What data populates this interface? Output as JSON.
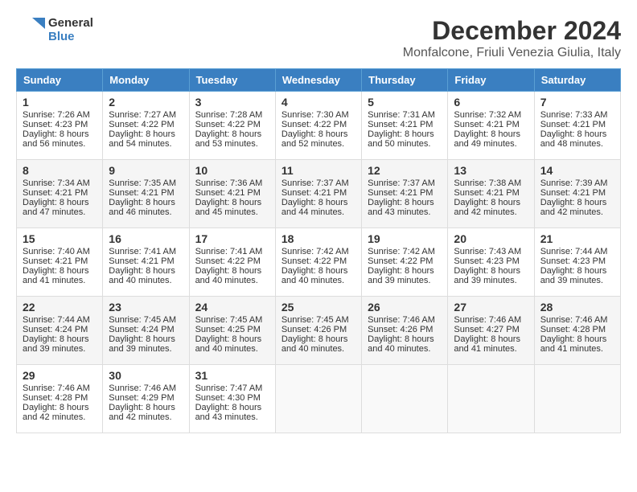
{
  "header": {
    "logo_line1": "General",
    "logo_line2": "Blue",
    "month_title": "December 2024",
    "location": "Monfalcone, Friuli Venezia Giulia, Italy"
  },
  "days_of_week": [
    "Sunday",
    "Monday",
    "Tuesday",
    "Wednesday",
    "Thursday",
    "Friday",
    "Saturday"
  ],
  "weeks": [
    [
      {
        "day": "1",
        "sunrise": "Sunrise: 7:26 AM",
        "sunset": "Sunset: 4:23 PM",
        "daylight": "Daylight: 8 hours and 56 minutes."
      },
      {
        "day": "2",
        "sunrise": "Sunrise: 7:27 AM",
        "sunset": "Sunset: 4:22 PM",
        "daylight": "Daylight: 8 hours and 54 minutes."
      },
      {
        "day": "3",
        "sunrise": "Sunrise: 7:28 AM",
        "sunset": "Sunset: 4:22 PM",
        "daylight": "Daylight: 8 hours and 53 minutes."
      },
      {
        "day": "4",
        "sunrise": "Sunrise: 7:30 AM",
        "sunset": "Sunset: 4:22 PM",
        "daylight": "Daylight: 8 hours and 52 minutes."
      },
      {
        "day": "5",
        "sunrise": "Sunrise: 7:31 AM",
        "sunset": "Sunset: 4:21 PM",
        "daylight": "Daylight: 8 hours and 50 minutes."
      },
      {
        "day": "6",
        "sunrise": "Sunrise: 7:32 AM",
        "sunset": "Sunset: 4:21 PM",
        "daylight": "Daylight: 8 hours and 49 minutes."
      },
      {
        "day": "7",
        "sunrise": "Sunrise: 7:33 AM",
        "sunset": "Sunset: 4:21 PM",
        "daylight": "Daylight: 8 hours and 48 minutes."
      }
    ],
    [
      {
        "day": "8",
        "sunrise": "Sunrise: 7:34 AM",
        "sunset": "Sunset: 4:21 PM",
        "daylight": "Daylight: 8 hours and 47 minutes."
      },
      {
        "day": "9",
        "sunrise": "Sunrise: 7:35 AM",
        "sunset": "Sunset: 4:21 PM",
        "daylight": "Daylight: 8 hours and 46 minutes."
      },
      {
        "day": "10",
        "sunrise": "Sunrise: 7:36 AM",
        "sunset": "Sunset: 4:21 PM",
        "daylight": "Daylight: 8 hours and 45 minutes."
      },
      {
        "day": "11",
        "sunrise": "Sunrise: 7:37 AM",
        "sunset": "Sunset: 4:21 PM",
        "daylight": "Daylight: 8 hours and 44 minutes."
      },
      {
        "day": "12",
        "sunrise": "Sunrise: 7:37 AM",
        "sunset": "Sunset: 4:21 PM",
        "daylight": "Daylight: 8 hours and 43 minutes."
      },
      {
        "day": "13",
        "sunrise": "Sunrise: 7:38 AM",
        "sunset": "Sunset: 4:21 PM",
        "daylight": "Daylight: 8 hours and 42 minutes."
      },
      {
        "day": "14",
        "sunrise": "Sunrise: 7:39 AM",
        "sunset": "Sunset: 4:21 PM",
        "daylight": "Daylight: 8 hours and 42 minutes."
      }
    ],
    [
      {
        "day": "15",
        "sunrise": "Sunrise: 7:40 AM",
        "sunset": "Sunset: 4:21 PM",
        "daylight": "Daylight: 8 hours and 41 minutes."
      },
      {
        "day": "16",
        "sunrise": "Sunrise: 7:41 AM",
        "sunset": "Sunset: 4:21 PM",
        "daylight": "Daylight: 8 hours and 40 minutes."
      },
      {
        "day": "17",
        "sunrise": "Sunrise: 7:41 AM",
        "sunset": "Sunset: 4:22 PM",
        "daylight": "Daylight: 8 hours and 40 minutes."
      },
      {
        "day": "18",
        "sunrise": "Sunrise: 7:42 AM",
        "sunset": "Sunset: 4:22 PM",
        "daylight": "Daylight: 8 hours and 40 minutes."
      },
      {
        "day": "19",
        "sunrise": "Sunrise: 7:42 AM",
        "sunset": "Sunset: 4:22 PM",
        "daylight": "Daylight: 8 hours and 39 minutes."
      },
      {
        "day": "20",
        "sunrise": "Sunrise: 7:43 AM",
        "sunset": "Sunset: 4:23 PM",
        "daylight": "Daylight: 8 hours and 39 minutes."
      },
      {
        "day": "21",
        "sunrise": "Sunrise: 7:44 AM",
        "sunset": "Sunset: 4:23 PM",
        "daylight": "Daylight: 8 hours and 39 minutes."
      }
    ],
    [
      {
        "day": "22",
        "sunrise": "Sunrise: 7:44 AM",
        "sunset": "Sunset: 4:24 PM",
        "daylight": "Daylight: 8 hours and 39 minutes."
      },
      {
        "day": "23",
        "sunrise": "Sunrise: 7:45 AM",
        "sunset": "Sunset: 4:24 PM",
        "daylight": "Daylight: 8 hours and 39 minutes."
      },
      {
        "day": "24",
        "sunrise": "Sunrise: 7:45 AM",
        "sunset": "Sunset: 4:25 PM",
        "daylight": "Daylight: 8 hours and 40 minutes."
      },
      {
        "day": "25",
        "sunrise": "Sunrise: 7:45 AM",
        "sunset": "Sunset: 4:26 PM",
        "daylight": "Daylight: 8 hours and 40 minutes."
      },
      {
        "day": "26",
        "sunrise": "Sunrise: 7:46 AM",
        "sunset": "Sunset: 4:26 PM",
        "daylight": "Daylight: 8 hours and 40 minutes."
      },
      {
        "day": "27",
        "sunrise": "Sunrise: 7:46 AM",
        "sunset": "Sunset: 4:27 PM",
        "daylight": "Daylight: 8 hours and 41 minutes."
      },
      {
        "day": "28",
        "sunrise": "Sunrise: 7:46 AM",
        "sunset": "Sunset: 4:28 PM",
        "daylight": "Daylight: 8 hours and 41 minutes."
      }
    ],
    [
      {
        "day": "29",
        "sunrise": "Sunrise: 7:46 AM",
        "sunset": "Sunset: 4:28 PM",
        "daylight": "Daylight: 8 hours and 42 minutes."
      },
      {
        "day": "30",
        "sunrise": "Sunrise: 7:46 AM",
        "sunset": "Sunset: 4:29 PM",
        "daylight": "Daylight: 8 hours and 42 minutes."
      },
      {
        "day": "31",
        "sunrise": "Sunrise: 7:47 AM",
        "sunset": "Sunset: 4:30 PM",
        "daylight": "Daylight: 8 hours and 43 minutes."
      },
      null,
      null,
      null,
      null
    ]
  ]
}
